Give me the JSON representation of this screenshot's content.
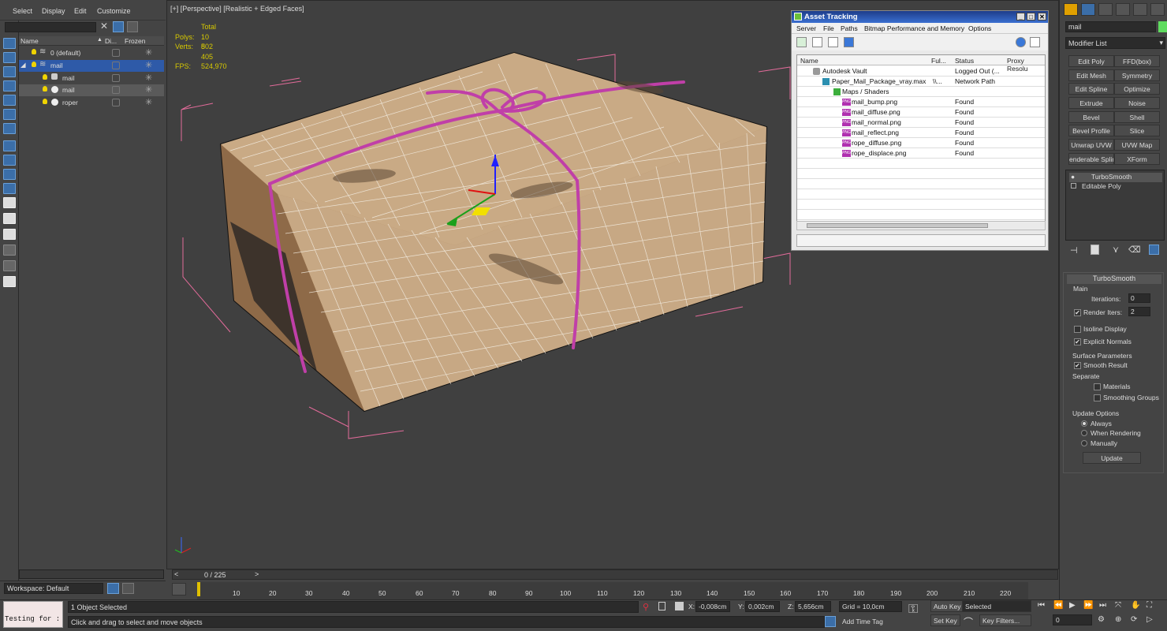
{
  "menu": [
    "Select",
    "Display",
    "Edit",
    "Customize"
  ],
  "scene_explorer": {
    "headers": {
      "name": "Name",
      "display": "Di...",
      "frozen": "Frozen"
    },
    "rows": [
      {
        "label": "0 (default)"
      },
      {
        "label": "mail"
      },
      {
        "label": "mail"
      },
      {
        "label": "mail"
      },
      {
        "label": "roper"
      }
    ]
  },
  "workspace": "Workspace: Default",
  "viewport": {
    "label": "[+] [Perspective] [Realistic + Edged Faces]",
    "stats": {
      "total": "Total",
      "polys_label": "Polys:",
      "polys": "10 802",
      "verts_label": "Verts:",
      "verts": "5 405",
      "fps_label": "FPS:",
      "fps": "524,970"
    }
  },
  "asset_tracking": {
    "title": "Asset Tracking",
    "menu": [
      "Server",
      "File",
      "Paths",
      "Bitmap Performance and Memory",
      "Options"
    ],
    "columns": [
      "Name",
      "Ful...",
      "Status",
      "Proxy Resolu"
    ],
    "rows": [
      {
        "name": "Autodesk Vault",
        "full": "",
        "status": "Logged Out (..."
      },
      {
        "name": "Paper_Mail_Package_vray.max",
        "full": "\\\\...",
        "status": "Network Path"
      },
      {
        "name": "Maps / Shaders",
        "full": "",
        "status": ""
      },
      {
        "name": "mail_bump.png",
        "full": "",
        "status": "Found"
      },
      {
        "name": "mail_diffuse.png",
        "full": "",
        "status": "Found"
      },
      {
        "name": "mail_normal.png",
        "full": "",
        "status": "Found"
      },
      {
        "name": "mail_reflect.png",
        "full": "",
        "status": "Found"
      },
      {
        "name": "rope_diffuse.png",
        "full": "",
        "status": "Found"
      },
      {
        "name": "rope_displace.png",
        "full": "",
        "status": "Found"
      }
    ]
  },
  "command_panel": {
    "object_name": "mail",
    "modifier_list": "Modifier List",
    "buttons": [
      "Edit Poly",
      "FFD(box)",
      "Edit Mesh",
      "Symmetry",
      "Edit Spline",
      "Optimize",
      "Extrude",
      "Noise",
      "Bevel",
      "Shell",
      "Bevel Profile",
      "Slice",
      "Unwrap UVW",
      "UVW Map",
      "enderable Splin",
      "XForm"
    ],
    "stack": [
      "TurboSmooth",
      "Editable Poly"
    ],
    "turbosmooth": {
      "title": "TurboSmooth",
      "main": "Main",
      "iterations_label": "Iterations:",
      "iterations": "0",
      "render_iters_label": "Render Iters:",
      "render_iters": "2",
      "isoline": "Isoline Display",
      "explicit": "Explicit Normals",
      "surface": "Surface Parameters",
      "smooth_result": "Smooth Result",
      "separate": "Separate",
      "materials": "Materials",
      "smoothing": "Smoothing Groups",
      "update_options": "Update Options",
      "always": "Always",
      "when_rendering": "When Rendering",
      "manually": "Manually",
      "update": "Update"
    }
  },
  "timeline": {
    "frame": "0 / 225",
    "ticks": [
      "10",
      "20",
      "30",
      "40",
      "50",
      "60",
      "70",
      "80",
      "90",
      "100",
      "110",
      "120",
      "130",
      "140",
      "150",
      "160",
      "170",
      "180",
      "190",
      "200",
      "210",
      "220"
    ]
  },
  "status": {
    "maxscript": "Testing for :",
    "selected": "1 Object Selected",
    "prompt": "Click and drag to select and move objects",
    "x_label": "X:",
    "x": "-0,008cm",
    "y_label": "Y:",
    "y": "0,002cm",
    "z_label": "Z:",
    "z": "5,656cm",
    "grid": "Grid = 10,0cm",
    "add_time_tag": "Add Time Tag",
    "auto_key": "Auto Key",
    "set_key": "Set Key",
    "selected_dropdown": "Selected",
    "key_filters": "Key Filters...",
    "current_frame": "0"
  },
  "colors": {
    "accent": "#2e5aa8",
    "rope": "#c03fa8",
    "box": "#c8a787",
    "stats": "#d7c900",
    "bbox": "#e26b9a"
  }
}
